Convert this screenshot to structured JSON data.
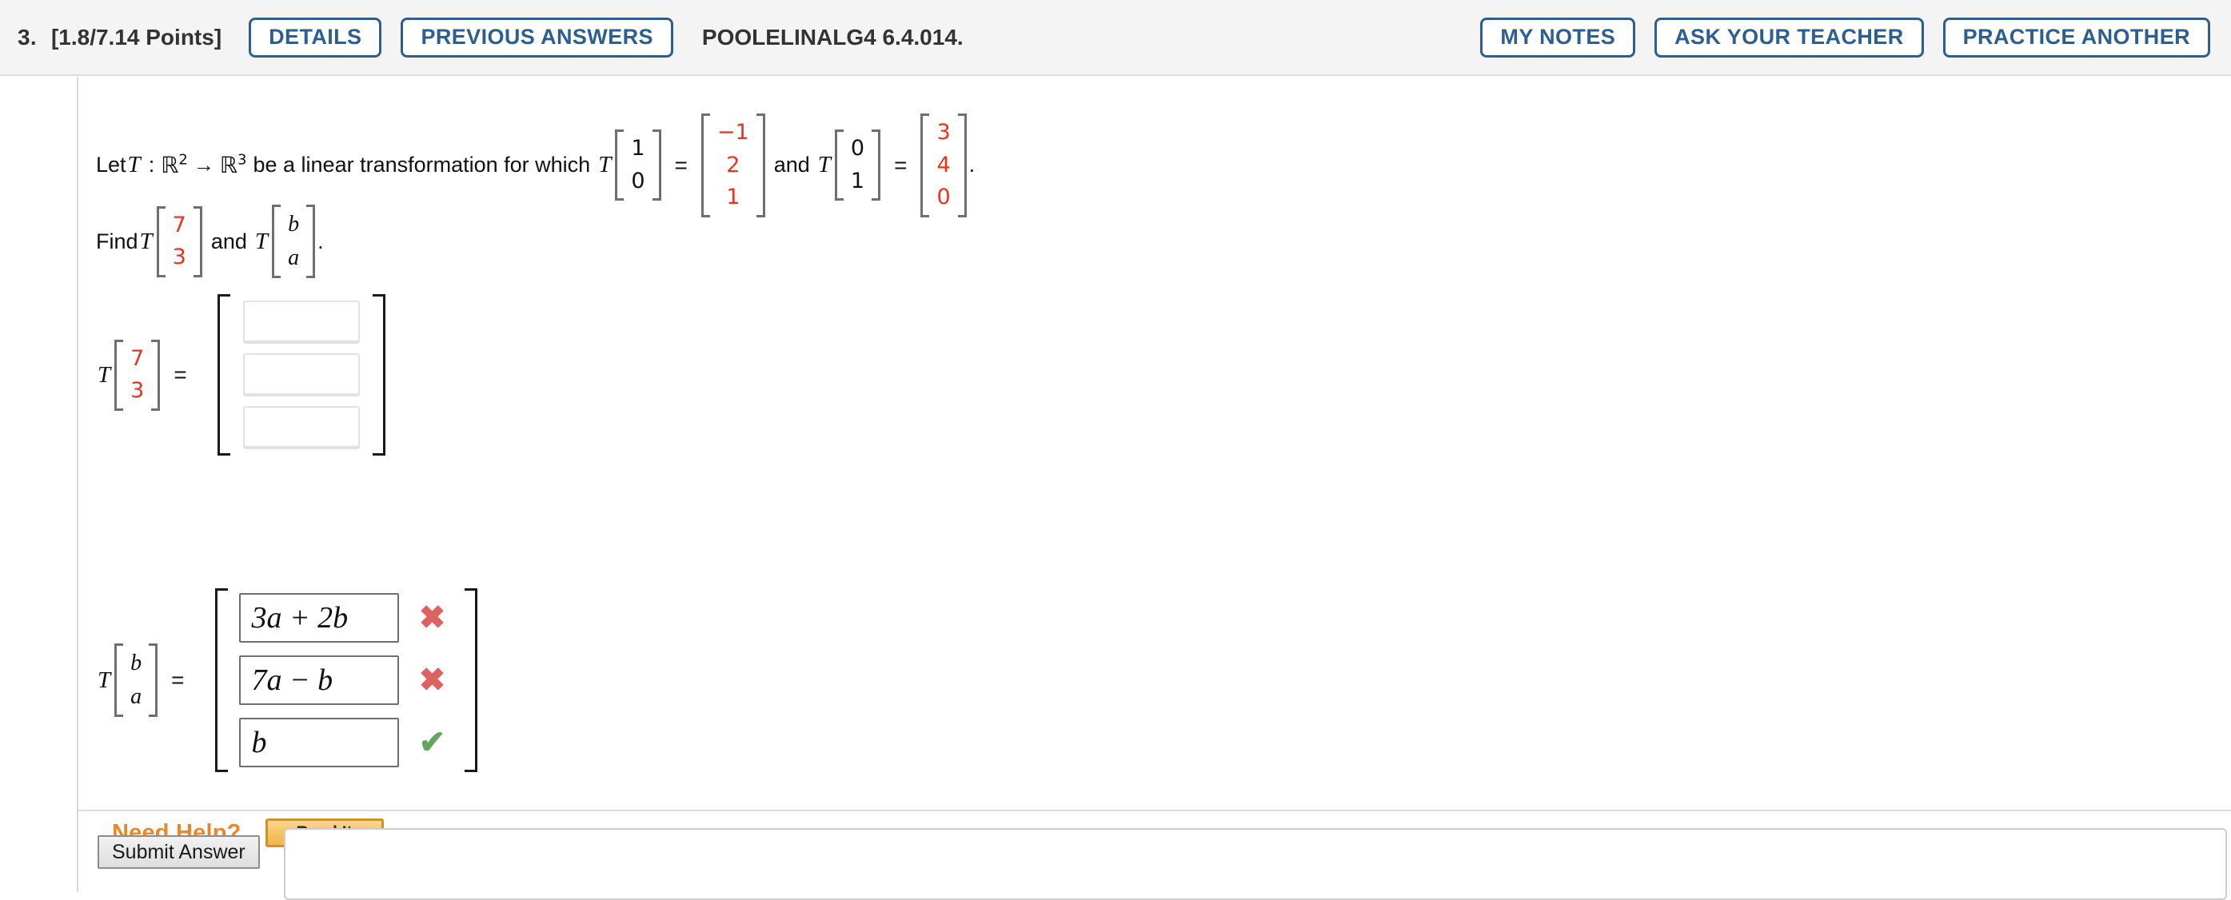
{
  "header": {
    "question_number": "3.",
    "points": "[1.8/7.14 Points]",
    "details_label": "DETAILS",
    "previous_answers_label": "PREVIOUS ANSWERS",
    "question_code": "POOLELINALG4 6.4.014.",
    "my_notes_label": "MY NOTES",
    "ask_teacher_label": "ASK YOUR TEACHER",
    "practice_another_label": "PRACTICE ANOTHER",
    "accent_blue": "#2c5f8f"
  },
  "problem": {
    "lead_text": "Let",
    "transform_symbol": "T",
    "colon": ":",
    "domain_base": "ℝ",
    "domain_exp": "2",
    "arrow": "→",
    "codomain_base": "ℝ",
    "codomain_exp": "3",
    "statement_text": "be a linear transformation for which",
    "and_text": "and",
    "period": ".",
    "equals": "=",
    "given1": {
      "input": [
        "1",
        "0"
      ],
      "output": [
        "−1",
        "2",
        "1"
      ]
    },
    "given2": {
      "input": [
        "0",
        "1"
      ],
      "output": [
        "3",
        "4",
        "0"
      ]
    },
    "find_label": "Find",
    "find_vec1": [
      "7",
      "3"
    ],
    "find_vec2": [
      "b",
      "a"
    ],
    "red_color": "#e8341f"
  },
  "answer1": {
    "input_vector": [
      "7",
      "3"
    ],
    "equals": "=",
    "entries": [
      "",
      "",
      ""
    ],
    "placeholder": ""
  },
  "answer2": {
    "input_vector": [
      "b",
      "a"
    ],
    "equals": "=",
    "entries": [
      {
        "value": "3a + 2b",
        "mark": "incorrect",
        "mark_glyph": "✖"
      },
      {
        "value": "7a − b",
        "mark": "incorrect",
        "mark_glyph": "✖"
      },
      {
        "value": "b",
        "mark": "correct",
        "mark_glyph": "✔"
      }
    ],
    "incorrect_color": "#dd6262",
    "correct_color": "#63a85a"
  },
  "help": {
    "label": "Need Help?",
    "read_it_label": "Read It",
    "label_color": "#e8882a"
  },
  "footer": {
    "submit_label": "Submit Answer"
  }
}
